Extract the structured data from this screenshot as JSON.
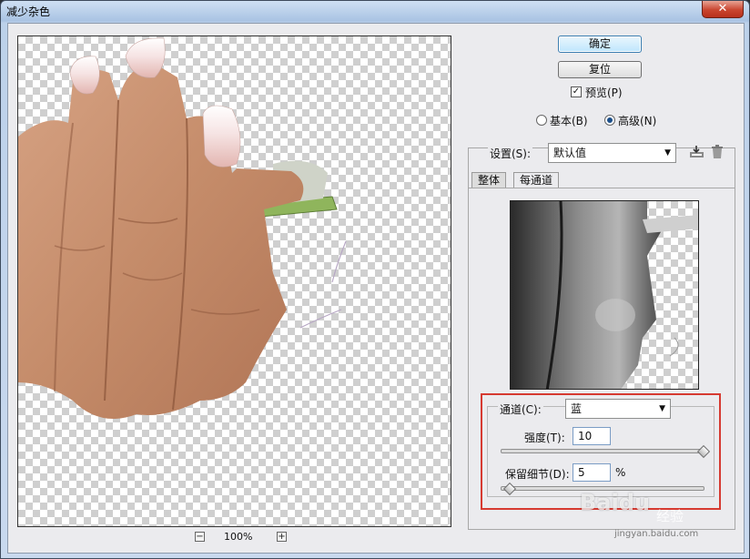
{
  "window": {
    "title": "减少杂色",
    "close_glyph": "✕"
  },
  "zoom": {
    "minus": "−",
    "value": "100%",
    "plus": "+"
  },
  "buttons": {
    "ok": "确定",
    "reset": "复位"
  },
  "preview_toggle": {
    "label": "预览(P)",
    "checked": true,
    "check_glyph": "✓"
  },
  "mode": {
    "basic": "基本(B)",
    "advanced": "高级(N)",
    "selected": "advanced"
  },
  "settings": {
    "label": "设置(S):",
    "value": "默认值",
    "save_icon": "save-icon",
    "delete_icon": "trash-icon"
  },
  "tabs": [
    {
      "label": "整体",
      "active": false
    },
    {
      "label": "每通道",
      "active": true
    }
  ],
  "channel_group": {
    "channel_label": "通道(C):",
    "channel_value": "蓝",
    "strength_label": "强度(T):",
    "strength_value": "10",
    "strength_fraction": 1.0,
    "detail_label": "保留细节(D):",
    "detail_value": "5",
    "detail_unit": "%",
    "detail_fraction": 0.05
  },
  "watermark": {
    "brand": "Baidu",
    "suffix": "经验",
    "url": "jingyan.baidu.com"
  },
  "colors": {
    "highlight": "#d63a31",
    "default_button": "#bee6fd"
  }
}
